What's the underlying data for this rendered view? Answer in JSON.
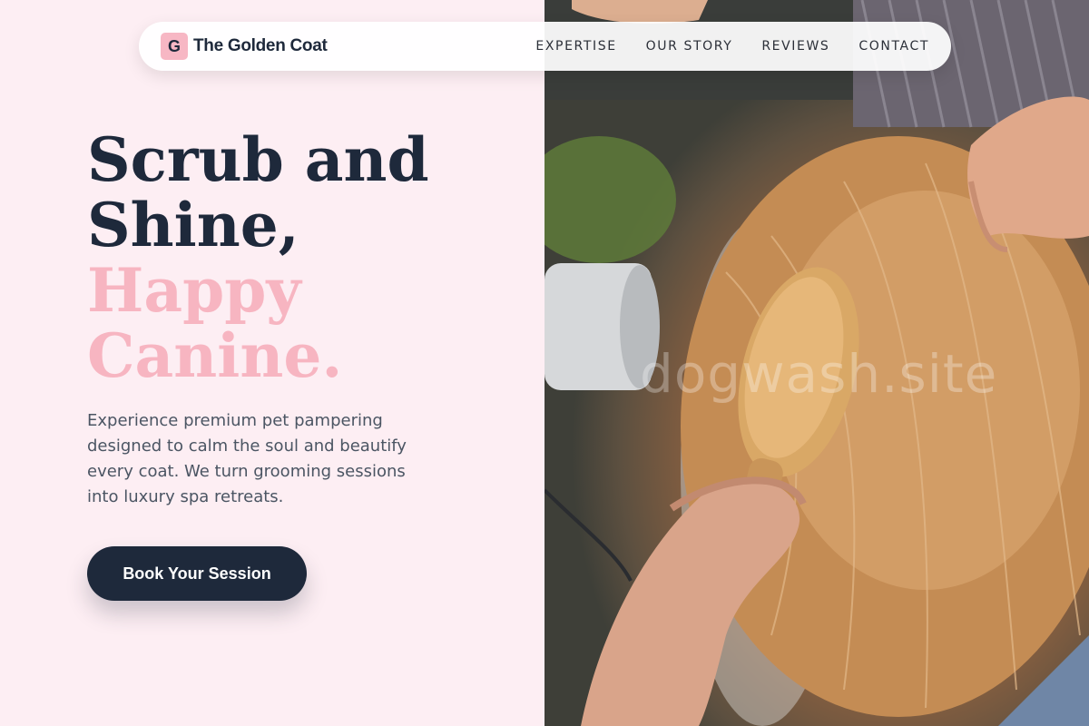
{
  "brand": {
    "badge_letter": "G",
    "name": "The Golden Coat"
  },
  "nav": {
    "links": [
      "EXPERTISE",
      "OUR STORY",
      "REVIEWS",
      "CONTACT"
    ]
  },
  "hero": {
    "title_dark": [
      "Scrub and",
      "Shine,"
    ],
    "title_accent": [
      "Happy",
      "Canine."
    ],
    "description": "Experience premium pet pampering designed to calm the soul and beautify every coat. We turn grooming sessions into luxury spa retreats.",
    "cta_label": "Book Your Session"
  },
  "photo": {
    "watermark": "dogwash.site"
  },
  "colors": {
    "background": "#fdeef3",
    "dark": "#1e293b",
    "accent_pink": "#f7b5c1"
  }
}
